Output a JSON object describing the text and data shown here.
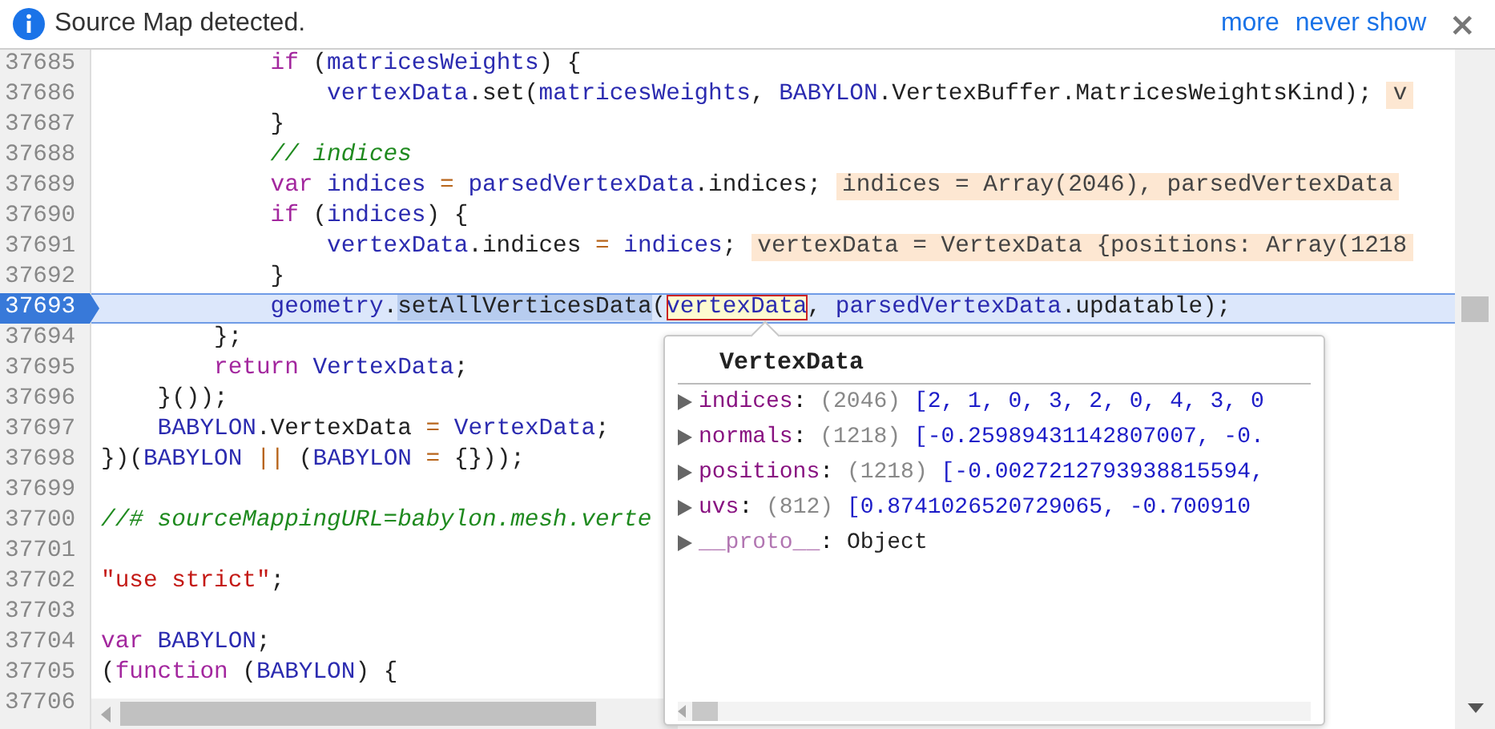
{
  "banner": {
    "message": "Source Map detected.",
    "links": [
      "more",
      "never show"
    ],
    "close": "×"
  },
  "editor": {
    "lines": [
      {
        "number": "37685",
        "selected": false,
        "tokens": [
          {
            "kind": "keyword",
            "text": "            if"
          },
          {
            "kind": "plain",
            "text": " ("
          },
          {
            "kind": "ident",
            "text": "matricesWeights"
          },
          {
            "kind": "plain",
            "text": ") {"
          }
        ]
      },
      {
        "number": "37686",
        "selected": false,
        "tokens": [
          {
            "kind": "ident",
            "text": "                vertexData"
          },
          {
            "kind": "plain",
            "text": ".set("
          },
          {
            "kind": "ident",
            "text": "matricesWeights"
          },
          {
            "kind": "plain",
            "text": ", "
          },
          {
            "kind": "ident",
            "text": "BABYLON"
          },
          {
            "kind": "plain",
            "text": ".VertexBuffer.MatricesWeightsKind);"
          }
        ],
        "value": "v"
      },
      {
        "number": "37687",
        "selected": false,
        "tokens": [
          {
            "kind": "plain",
            "text": "            }"
          }
        ]
      },
      {
        "number": "37688",
        "selected": false,
        "tokens": [
          {
            "kind": "comment",
            "text": "            // indices"
          }
        ]
      },
      {
        "number": "37689",
        "selected": false,
        "tokens": [
          {
            "kind": "keyword",
            "text": "            var"
          },
          {
            "kind": "ident",
            "text": " indices"
          },
          {
            "kind": "op",
            "text": " = "
          },
          {
            "kind": "ident",
            "text": "parsedVertexData"
          },
          {
            "kind": "plain",
            "text": ".indices;"
          }
        ],
        "value": "indices = Array(2046), parsedVertexData"
      },
      {
        "number": "37690",
        "selected": false,
        "tokens": [
          {
            "kind": "keyword",
            "text": "            if"
          },
          {
            "kind": "plain",
            "text": " ("
          },
          {
            "kind": "ident",
            "text": "indices"
          },
          {
            "kind": "plain",
            "text": ") {"
          }
        ]
      },
      {
        "number": "37691",
        "selected": false,
        "tokens": [
          {
            "kind": "ident",
            "text": "                vertexData"
          },
          {
            "kind": "plain",
            "text": ".indices"
          },
          {
            "kind": "op",
            "text": " = "
          },
          {
            "kind": "ident",
            "text": "indices"
          },
          {
            "kind": "plain",
            "text": ";"
          }
        ],
        "value": "vertexData = VertexData {positions: Array(1218"
      },
      {
        "number": "37692",
        "selected": false,
        "tokens": [
          {
            "kind": "plain",
            "text": "            }"
          }
        ]
      },
      {
        "number": "37693",
        "selected": true,
        "tokens": [
          {
            "kind": "ident",
            "text": "            geometry"
          },
          {
            "kind": "plain",
            "text": "."
          },
          {
            "kind": "selection",
            "text": "setAllVerticesData"
          },
          {
            "kind": "plain",
            "text": "("
          },
          {
            "kind": "hover",
            "text": "vertexData"
          },
          {
            "kind": "plain",
            "text": ", "
          },
          {
            "kind": "ident",
            "text": "parsedVertexData"
          },
          {
            "kind": "plain",
            "text": ".updatable);"
          }
        ]
      },
      {
        "number": "37694",
        "selected": false,
        "tokens": [
          {
            "kind": "plain",
            "text": "        };"
          }
        ]
      },
      {
        "number": "37695",
        "selected": false,
        "tokens": [
          {
            "kind": "keyword",
            "text": "        return"
          },
          {
            "kind": "ident",
            "text": " VertexData"
          },
          {
            "kind": "plain",
            "text": ";"
          }
        ]
      },
      {
        "number": "37696",
        "selected": false,
        "tokens": [
          {
            "kind": "plain",
            "text": "    }());"
          }
        ]
      },
      {
        "number": "37697",
        "selected": false,
        "tokens": [
          {
            "kind": "ident",
            "text": "    BABYLON"
          },
          {
            "kind": "plain",
            "text": ".VertexData"
          },
          {
            "kind": "op",
            "text": " = "
          },
          {
            "kind": "ident",
            "text": "VertexData"
          },
          {
            "kind": "plain",
            "text": ";"
          }
        ]
      },
      {
        "number": "37698",
        "selected": false,
        "tokens": [
          {
            "kind": "plain",
            "text": "})("
          },
          {
            "kind": "ident",
            "text": "BABYLON"
          },
          {
            "kind": "op",
            "text": " || "
          },
          {
            "kind": "plain",
            "text": "("
          },
          {
            "kind": "ident",
            "text": "BABYLON"
          },
          {
            "kind": "op",
            "text": " = "
          },
          {
            "kind": "plain",
            "text": "{}));"
          }
        ]
      },
      {
        "number": "37699",
        "selected": false
      },
      {
        "number": "37700",
        "selected": false,
        "tokens": [
          {
            "kind": "comment",
            "text": "//# sourceMappingURL=babylon.mesh.verte"
          }
        ]
      },
      {
        "number": "37701",
        "selected": false
      },
      {
        "number": "37702",
        "selected": false,
        "tokens": [
          {
            "kind": "string",
            "text": "\"use strict\""
          },
          {
            "kind": "plain",
            "text": ";"
          }
        ]
      },
      {
        "number": "37703",
        "selected": false
      },
      {
        "number": "37704",
        "selected": false,
        "tokens": [
          {
            "kind": "keyword",
            "text": "var"
          },
          {
            "kind": "ident",
            "text": " BABYLON"
          },
          {
            "kind": "plain",
            "text": ";"
          }
        ]
      },
      {
        "number": "37705",
        "selected": false,
        "tokens": [
          {
            "kind": "plain",
            "text": "("
          },
          {
            "kind": "keyword",
            "text": "function"
          },
          {
            "kind": "plain",
            "text": " ("
          },
          {
            "kind": "ident",
            "text": "BABYLON"
          },
          {
            "kind": "plain",
            "text": ") {"
          }
        ]
      },
      {
        "number": "37706",
        "selected": false
      }
    ]
  },
  "popup": {
    "title": "VertexData",
    "properties": [
      {
        "kind": "own",
        "name": "indices",
        "separator": ":",
        "count": "(2046)",
        "preview": "[2, 1, 0, 3, 2, 0, 4, 3, 0"
      },
      {
        "kind": "own",
        "name": "normals",
        "separator": ":",
        "count": "(1218)",
        "preview": "[-0.25989431142807007, -0."
      },
      {
        "kind": "own",
        "name": "positions",
        "separator": ":",
        "count": "(1218)",
        "preview": "[-0.0027212793938815594,"
      },
      {
        "kind": "own",
        "name": "uvs",
        "separator": ":",
        "count": "(812)",
        "preview": "[0.8741026520729065, -0.700910"
      },
      {
        "kind": "proto",
        "name": "__proto__",
        "separator": ":",
        "preview": "Object"
      }
    ]
  }
}
